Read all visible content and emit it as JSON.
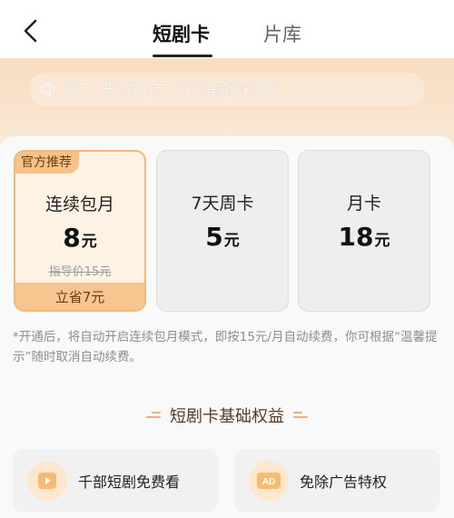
{
  "header": {
    "tabs": [
      {
        "label": "短剧卡",
        "active": true
      },
      {
        "label": "片库",
        "active": false
      }
    ]
  },
  "notice": {
    "text": "提示：开通短剧卡，尊享海量精彩短剧",
    "icon": "speaker-icon"
  },
  "plans": [
    {
      "badge": "官方推荐",
      "name": "连续包月",
      "price": "8",
      "unit": "元",
      "guide_price": "指导价15元",
      "savings": "立省7元",
      "selected": true
    },
    {
      "name": "7天周卡",
      "price": "5",
      "unit": "元",
      "selected": false
    },
    {
      "name": "月卡",
      "price": "18",
      "unit": "元",
      "selected": false
    }
  ],
  "footnote": "*开通后，将自动开启连续包月模式，即按15元/月自动续费，你可根据“温馨提示”随时取消自动续费。",
  "benefits": {
    "title": "短剧卡基础权益",
    "items": [
      {
        "label": "千部短剧免费看",
        "icon": "play-icon"
      },
      {
        "label": "免除广告特权",
        "icon": "ad-free-icon"
      }
    ]
  },
  "colors": {
    "accent": "#f4b778",
    "badge_bg": "#f7c28a",
    "badge_text": "#6b3a12",
    "hero_bg": "#f8dcc0"
  }
}
